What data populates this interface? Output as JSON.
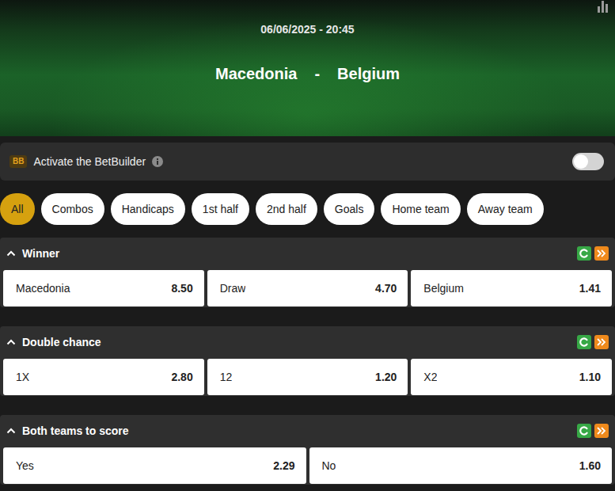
{
  "header": {
    "datetime": "06/06/2025 - 20:45",
    "home": "Macedonia",
    "separator": "-",
    "away": "Belgium"
  },
  "betbuilder": {
    "badge": "BB",
    "label": "Activate the BetBuilder",
    "on": false
  },
  "filters": [
    {
      "label": "All",
      "selected": true
    },
    {
      "label": "Combos",
      "selected": false
    },
    {
      "label": "Handicaps",
      "selected": false
    },
    {
      "label": "1st half",
      "selected": false
    },
    {
      "label": "2nd half",
      "selected": false
    },
    {
      "label": "Goals",
      "selected": false
    },
    {
      "label": "Home team",
      "selected": false
    },
    {
      "label": "Away team",
      "selected": false
    }
  ],
  "markets": [
    {
      "title": "Winner",
      "expanded": true,
      "outcomes": [
        {
          "label": "Macedonia",
          "odds": "8.50"
        },
        {
          "label": "Draw",
          "odds": "4.70"
        },
        {
          "label": "Belgium",
          "odds": "1.41"
        }
      ]
    },
    {
      "title": "Double chance",
      "expanded": true,
      "outcomes": [
        {
          "label": "1X",
          "odds": "2.80"
        },
        {
          "label": "12",
          "odds": "1.20"
        },
        {
          "label": "X2",
          "odds": "1.10"
        }
      ]
    },
    {
      "title": "Both teams to score",
      "expanded": true,
      "outcomes": [
        {
          "label": "Yes",
          "odds": "2.29"
        },
        {
          "label": "No",
          "odds": "1.60"
        }
      ]
    }
  ]
}
